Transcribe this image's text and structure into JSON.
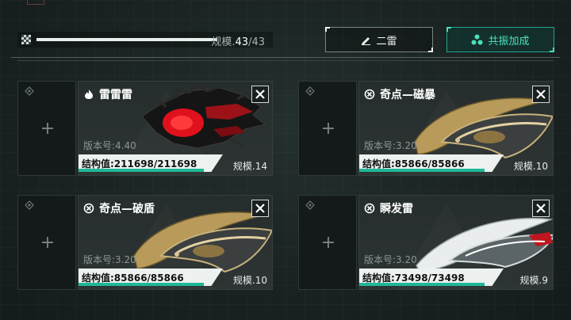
{
  "header": {
    "capacity_label": "规模.",
    "capacity_current": "43",
    "capacity_max": "/43",
    "capacity_fraction": 1.0,
    "rename_button": "二雷",
    "resonance_button": "共振加成"
  },
  "colors": {
    "accent": "#1fb896",
    "resonance_text": "#4be0bd",
    "struct_bar": "#1fb896"
  },
  "cards": [
    {
      "name": "雷雷雷",
      "type_icon": "flame-icon",
      "version": "版本号:4.40",
      "structure": "结构值:211698/211698",
      "level": "规模.14",
      "ship": "red-dreadnought"
    },
    {
      "name": "奇点—磁暴",
      "type_icon": "target-icon",
      "version": "版本号:3.20",
      "structure": "结构值:85866/85866",
      "level": "规模.10",
      "ship": "gold-crescent"
    },
    {
      "name": "奇点—破盾",
      "type_icon": "target-icon",
      "version": "版本号:3.20",
      "structure": "结构值:85866/85866",
      "level": "规模.10",
      "ship": "gold-crescent"
    },
    {
      "name": "瞬发雷",
      "type_icon": "target-icon",
      "version": "版本号:3.20",
      "structure": "结构值:73498/73498",
      "level": "规模.9",
      "ship": "silver-crescent"
    }
  ]
}
